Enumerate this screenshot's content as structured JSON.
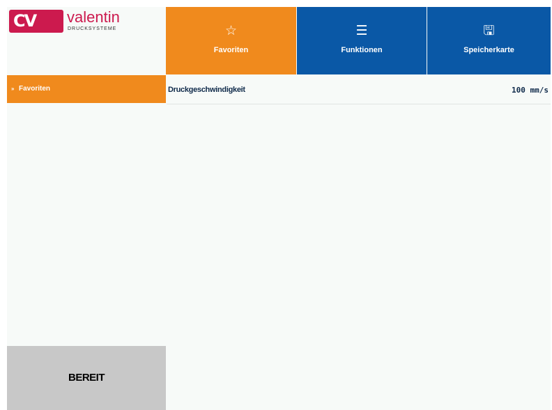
{
  "brand": {
    "logo_letters": "CV",
    "name": "valentin",
    "subtitle": "DRUCKSYSTEME",
    "color": "#cc1a4e"
  },
  "tabs": [
    {
      "label": "Favoriten",
      "icon": "star-icon",
      "icon_glyph": "☆",
      "active": true
    },
    {
      "label": "Funktionen",
      "icon": "list-icon",
      "icon_glyph": "☰",
      "active": false
    },
    {
      "label": "Speicherkarte",
      "icon": "save-icon",
      "icon_glyph": "🖫",
      "active": false
    }
  ],
  "sidebar": {
    "items": [
      {
        "label": "Favoriten",
        "icon": "chevron-right-icon",
        "glyph": "»",
        "active": true
      }
    ]
  },
  "status": {
    "text": "BEREIT"
  },
  "main": {
    "rows": [
      {
        "name": "Druckgeschwindigkeit",
        "value": "100 mm/s"
      }
    ]
  },
  "colors": {
    "accent_orange": "#f08a1d",
    "nav_blue": "#0a58a6",
    "status_gray": "#c8c8c8",
    "background": "#f7faf8"
  }
}
